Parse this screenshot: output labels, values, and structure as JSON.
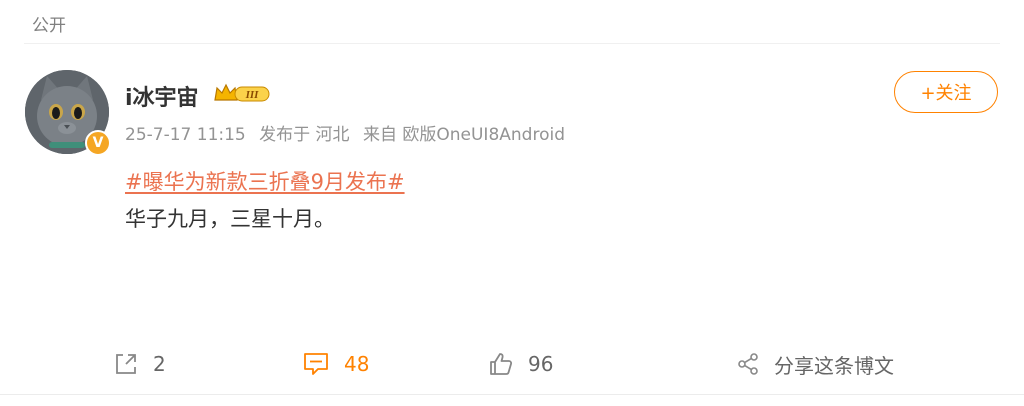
{
  "post": {
    "visibility": "公开",
    "author": {
      "name": "i冰宇宙",
      "badge_label": "III",
      "verified_mark": "V"
    },
    "meta": {
      "timestamp": "25-7-17 11:15",
      "location": "发布于 河北",
      "source": "来自 欧版OneUI8Android"
    },
    "follow_label": "+关注",
    "topic": "#曝华为新款三折叠9月发布#",
    "text": "华子九月，三星十月。",
    "actions": {
      "repost_count": "2",
      "comment_count": "48",
      "like_count": "96",
      "share_label": "分享这条博文"
    },
    "colors": {
      "accent": "#ff8200",
      "topic": "#eb7350",
      "meta": "#939393",
      "text": "#333333"
    }
  }
}
